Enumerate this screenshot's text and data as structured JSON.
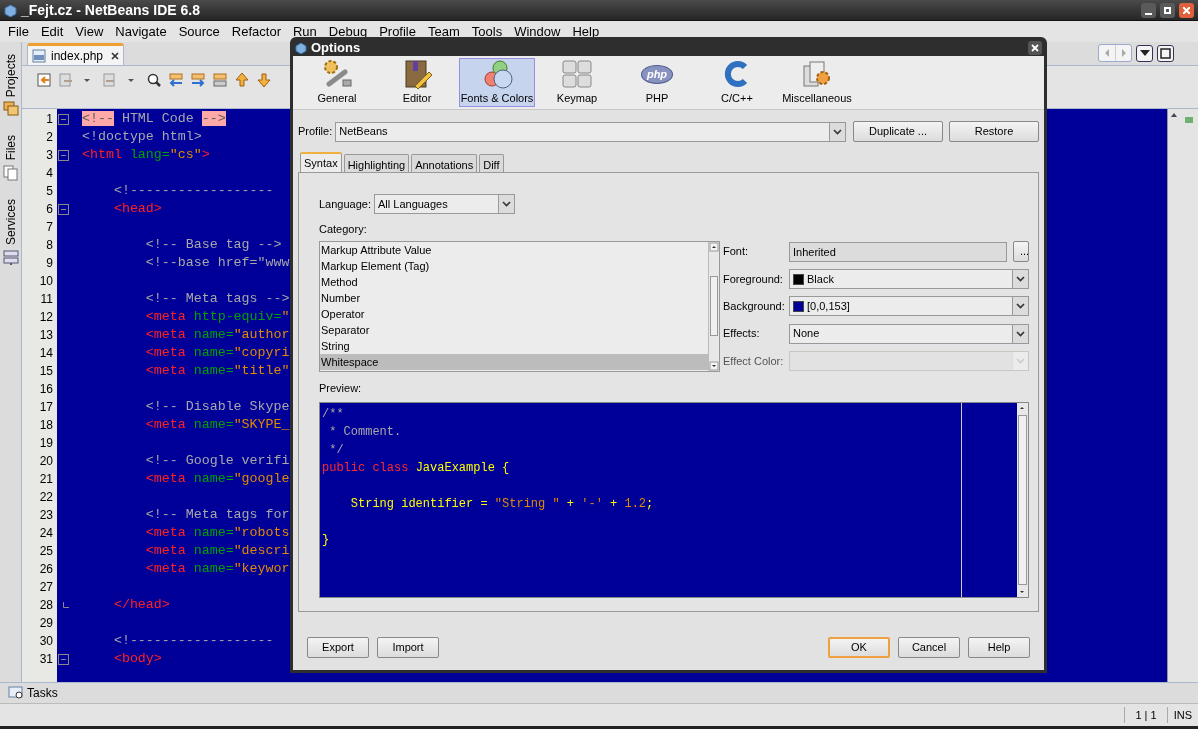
{
  "window": {
    "title": "_Fejt.cz - NetBeans IDE 6.8"
  },
  "menu": [
    "File",
    "Edit",
    "View",
    "Navigate",
    "Source",
    "Refactor",
    "Run",
    "Debug",
    "Profile",
    "Team",
    "Tools",
    "Window",
    "Help"
  ],
  "side_tabs": [
    {
      "label": "Projects"
    },
    {
      "label": "Files"
    },
    {
      "label": "Services"
    }
  ],
  "editor": {
    "tabs": [
      {
        "label": "index.php",
        "selected": true
      }
    ],
    "lines": [
      {
        "number": "1",
        "kind": "foldstart",
        "segments": [
          {
            "kind": "comment_hl",
            "text": "<!--"
          },
          {
            "kind": "comment",
            "text": " HTML Code "
          },
          {
            "kind": "comment_hl",
            "text": "-->"
          }
        ]
      },
      {
        "number": "2",
        "kind": "plain",
        "segments": [
          {
            "kind": "comment",
            "text": "<!doctype html>"
          }
        ]
      },
      {
        "number": "3",
        "kind": "foldstart",
        "segments": [
          {
            "kind": "tag",
            "text": "<html"
          },
          {
            "kind": "attr",
            "text": " lang="
          },
          {
            "kind": "string",
            "text": "\"cs\""
          },
          {
            "kind": "tag",
            "text": ">"
          }
        ]
      },
      {
        "number": "4",
        "kind": "plain"
      },
      {
        "number": "5",
        "kind": "plain",
        "segments": [
          {
            "kind": "comment",
            "text": "    <!------------------"
          }
        ]
      },
      {
        "number": "6",
        "kind": "foldstart",
        "segments": [
          {
            "kind": "tag",
            "text": "    <head>"
          }
        ]
      },
      {
        "number": "7",
        "kind": "plain"
      },
      {
        "number": "8",
        "kind": "plain",
        "segments": [
          {
            "kind": "comment",
            "text": "        <!-- Base tag -->"
          }
        ]
      },
      {
        "number": "9",
        "kind": "plain",
        "segments": [
          {
            "kind": "comment",
            "text": "        <!--base href=\"www"
          }
        ]
      },
      {
        "number": "10",
        "kind": "plain"
      },
      {
        "number": "11",
        "kind": "plain",
        "segments": [
          {
            "kind": "comment",
            "text": "        <!-- Meta tags -->"
          }
        ]
      },
      {
        "number": "12",
        "kind": "plain",
        "segments": [
          {
            "kind": "tag",
            "text": "        <meta"
          },
          {
            "kind": "attr",
            "text": " http-equiv="
          },
          {
            "kind": "string",
            "text": "\""
          }
        ]
      },
      {
        "number": "13",
        "kind": "plain",
        "segments": [
          {
            "kind": "tag",
            "text": "        <meta"
          },
          {
            "kind": "attr",
            "text": " name="
          },
          {
            "kind": "string",
            "text": "\"author"
          }
        ]
      },
      {
        "number": "14",
        "kind": "plain",
        "segments": [
          {
            "kind": "tag",
            "text": "        <meta"
          },
          {
            "kind": "attr",
            "text": " name="
          },
          {
            "kind": "string",
            "text": "\"copyri"
          }
        ]
      },
      {
        "number": "15",
        "kind": "plain",
        "segments": [
          {
            "kind": "tag",
            "text": "        <meta"
          },
          {
            "kind": "attr",
            "text": " name="
          },
          {
            "kind": "string",
            "text": "\"title\""
          }
        ]
      },
      {
        "number": "16",
        "kind": "plain"
      },
      {
        "number": "17",
        "kind": "plain",
        "segments": [
          {
            "kind": "comment",
            "text": "        <!-- Disable Skype"
          }
        ]
      },
      {
        "number": "18",
        "kind": "plain",
        "segments": [
          {
            "kind": "tag",
            "text": "        <meta"
          },
          {
            "kind": "attr",
            "text": " name="
          },
          {
            "kind": "string",
            "text": "\"SKYPE_"
          }
        ]
      },
      {
        "number": "19",
        "kind": "plain"
      },
      {
        "number": "20",
        "kind": "plain",
        "segments": [
          {
            "kind": "comment",
            "text": "        <!-- Google verifi"
          }
        ]
      },
      {
        "number": "21",
        "kind": "plain",
        "segments": [
          {
            "kind": "tag",
            "text": "        <meta"
          },
          {
            "kind": "attr",
            "text": " name="
          },
          {
            "kind": "string",
            "text": "\"google"
          }
        ]
      },
      {
        "number": "22",
        "kind": "plain"
      },
      {
        "number": "23",
        "kind": "plain",
        "segments": [
          {
            "kind": "comment",
            "text": "        <!-- Meta tags for"
          }
        ]
      },
      {
        "number": "24",
        "kind": "plain",
        "segments": [
          {
            "kind": "tag",
            "text": "        <meta"
          },
          {
            "kind": "attr",
            "text": " name="
          },
          {
            "kind": "string",
            "text": "\"robots"
          }
        ]
      },
      {
        "number": "25",
        "kind": "plain",
        "segments": [
          {
            "kind": "tag",
            "text": "        <meta"
          },
          {
            "kind": "attr",
            "text": " name="
          },
          {
            "kind": "string",
            "text": "\"descri"
          }
        ]
      },
      {
        "number": "26",
        "kind": "plain",
        "segments": [
          {
            "kind": "tag",
            "text": "        <meta"
          },
          {
            "kind": "attr",
            "text": " name="
          },
          {
            "kind": "string",
            "text": "\"keywor"
          }
        ]
      },
      {
        "number": "27",
        "kind": "plain"
      },
      {
        "number": "28",
        "kind": "foldend",
        "segments": [
          {
            "kind": "tag",
            "text": "    </head>"
          }
        ]
      },
      {
        "number": "29",
        "kind": "plain"
      },
      {
        "number": "30",
        "kind": "plain",
        "segments": [
          {
            "kind": "comment",
            "text": "    <!------------------"
          }
        ]
      },
      {
        "number": "31",
        "kind": "foldstart",
        "segments": [
          {
            "kind": "tag",
            "text": "    <body>"
          }
        ]
      }
    ]
  },
  "bottom_panel": {
    "label": "Tasks"
  },
  "status_bar": {
    "position": "1 | 1",
    "mode": "INS"
  },
  "options_dialog": {
    "title": "Options",
    "categories": [
      {
        "label": "General",
        "selected": false
      },
      {
        "label": "Editor",
        "selected": false
      },
      {
        "label": "Fonts & Colors",
        "selected": true
      },
      {
        "label": "Keymap",
        "selected": false
      },
      {
        "label": "PHP",
        "selected": false,
        "icon_text": "php"
      },
      {
        "label": "C/C++",
        "selected": false
      },
      {
        "label": "Miscellaneous",
        "selected": false
      }
    ],
    "profile": {
      "label": "Profile:",
      "value": "NetBeans"
    },
    "profile_buttons": [
      "Duplicate ...",
      "Restore"
    ],
    "tabs": [
      {
        "label": "Syntax",
        "selected": true
      },
      {
        "label": "Highlighting",
        "selected": false
      },
      {
        "label": "Annotations",
        "selected": false
      },
      {
        "label": "Diff",
        "selected": false
      }
    ],
    "language": {
      "label": "Language:",
      "value": "All Languages"
    },
    "category_label": "Category:",
    "category_items": [
      {
        "label": "Markup Attribute Value",
        "selected": false
      },
      {
        "label": "Markup Element (Tag)",
        "selected": false
      },
      {
        "label": "Method",
        "selected": false
      },
      {
        "label": "Number",
        "selected": false
      },
      {
        "label": "Operator",
        "selected": false
      },
      {
        "label": "Separator",
        "selected": false
      },
      {
        "label": "String",
        "selected": false
      },
      {
        "label": "Whitespace",
        "selected": true
      }
    ],
    "properties": [
      {
        "kind": "font",
        "label": "Font:",
        "value": "Inherited",
        "button": "...",
        "disabled": false
      },
      {
        "kind": "color",
        "label": "Foreground:",
        "value": "Black",
        "color": "#000000",
        "disabled": false
      },
      {
        "kind": "color",
        "label": "Background:",
        "value": "[0,0,153]",
        "color": "#000099",
        "disabled": false
      },
      {
        "kind": "combo",
        "label": "Effects:",
        "value": "None",
        "disabled": false
      },
      {
        "kind": "combo",
        "label": "Effect Color:",
        "disabled": true
      }
    ],
    "preview_label": "Preview:",
    "preview_lines": [
      {
        "kind": "code",
        "segments": [
          {
            "kind": "comment",
            "text": "/**"
          }
        ]
      },
      {
        "kind": "code",
        "segments": [
          {
            "kind": "comment",
            "text": " * Comment."
          }
        ]
      },
      {
        "kind": "code",
        "segments": [
          {
            "kind": "comment",
            "text": " */"
          }
        ]
      },
      {
        "kind": "code",
        "segments": [
          {
            "kind": "keyword",
            "text": "public class "
          },
          {
            "kind": "ident",
            "text": "JavaExample {"
          }
        ]
      },
      {
        "kind": "blank"
      },
      {
        "kind": "code",
        "segments": [
          {
            "kind": "ident",
            "text": "    String identifier = "
          },
          {
            "kind": "string",
            "text": "\"String \""
          },
          {
            "kind": "ident",
            "text": " + "
          },
          {
            "kind": "string",
            "text": "'-'"
          },
          {
            "kind": "ident",
            "text": " + "
          },
          {
            "kind": "string",
            "text": "1.2"
          },
          {
            "kind": "ident",
            "text": ";"
          }
        ]
      },
      {
        "kind": "blank"
      },
      {
        "kind": "code",
        "segments": [
          {
            "kind": "ident",
            "text": "}"
          }
        ]
      }
    ],
    "left_buttons": [
      "Export",
      "Import"
    ],
    "right_buttons": [
      {
        "label": "OK",
        "focused": true
      },
      {
        "label": "Cancel",
        "focused": false
      },
      {
        "label": "Help",
        "focused": false
      }
    ]
  }
}
